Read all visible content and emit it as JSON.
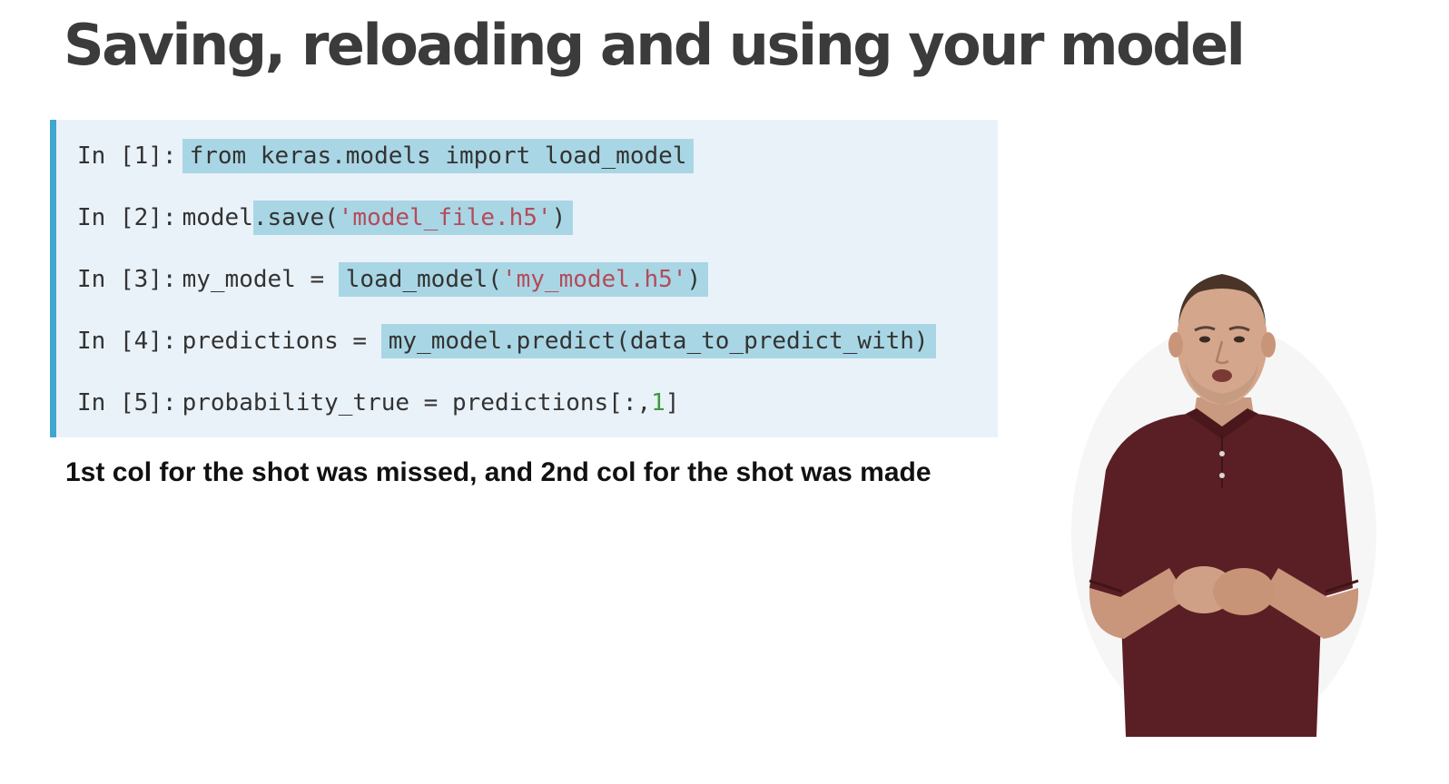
{
  "slide": {
    "title": "Saving, reloading and using your model",
    "caption": "1st col for the shot was missed, and 2nd col for the shot was made"
  },
  "code_cells": [
    {
      "prompt": "In [1]:",
      "pre": "",
      "hl": "from keras.models import load_model",
      "post": ""
    },
    {
      "prompt": "In [2]:",
      "pre": "model",
      "hl_a": ".save(",
      "hl_str": "'model_file.h5'",
      "hl_b": ")"
    },
    {
      "prompt": "In [3]:",
      "pre": "my_model = ",
      "hl_a": "load_model(",
      "hl_str": "'my_model.h5'",
      "hl_b": ")"
    },
    {
      "prompt": "In [4]:",
      "pre": "predictions = ",
      "hl": "my_model.predict(data_to_predict_with)"
    },
    {
      "prompt": "In [5]:",
      "pre": "probability_true = predictions[:,",
      "num": "1",
      "post": "]"
    }
  ],
  "colors": {
    "code_background": "#eaf2f9",
    "code_accent_bar": "#3fa7d0",
    "highlight": "#a9d6e5",
    "string": "#b44b5a",
    "number": "#3a9a3a",
    "shirt": "#5a1f24"
  },
  "icons": {
    "presenter": "presenter-video-figure"
  }
}
